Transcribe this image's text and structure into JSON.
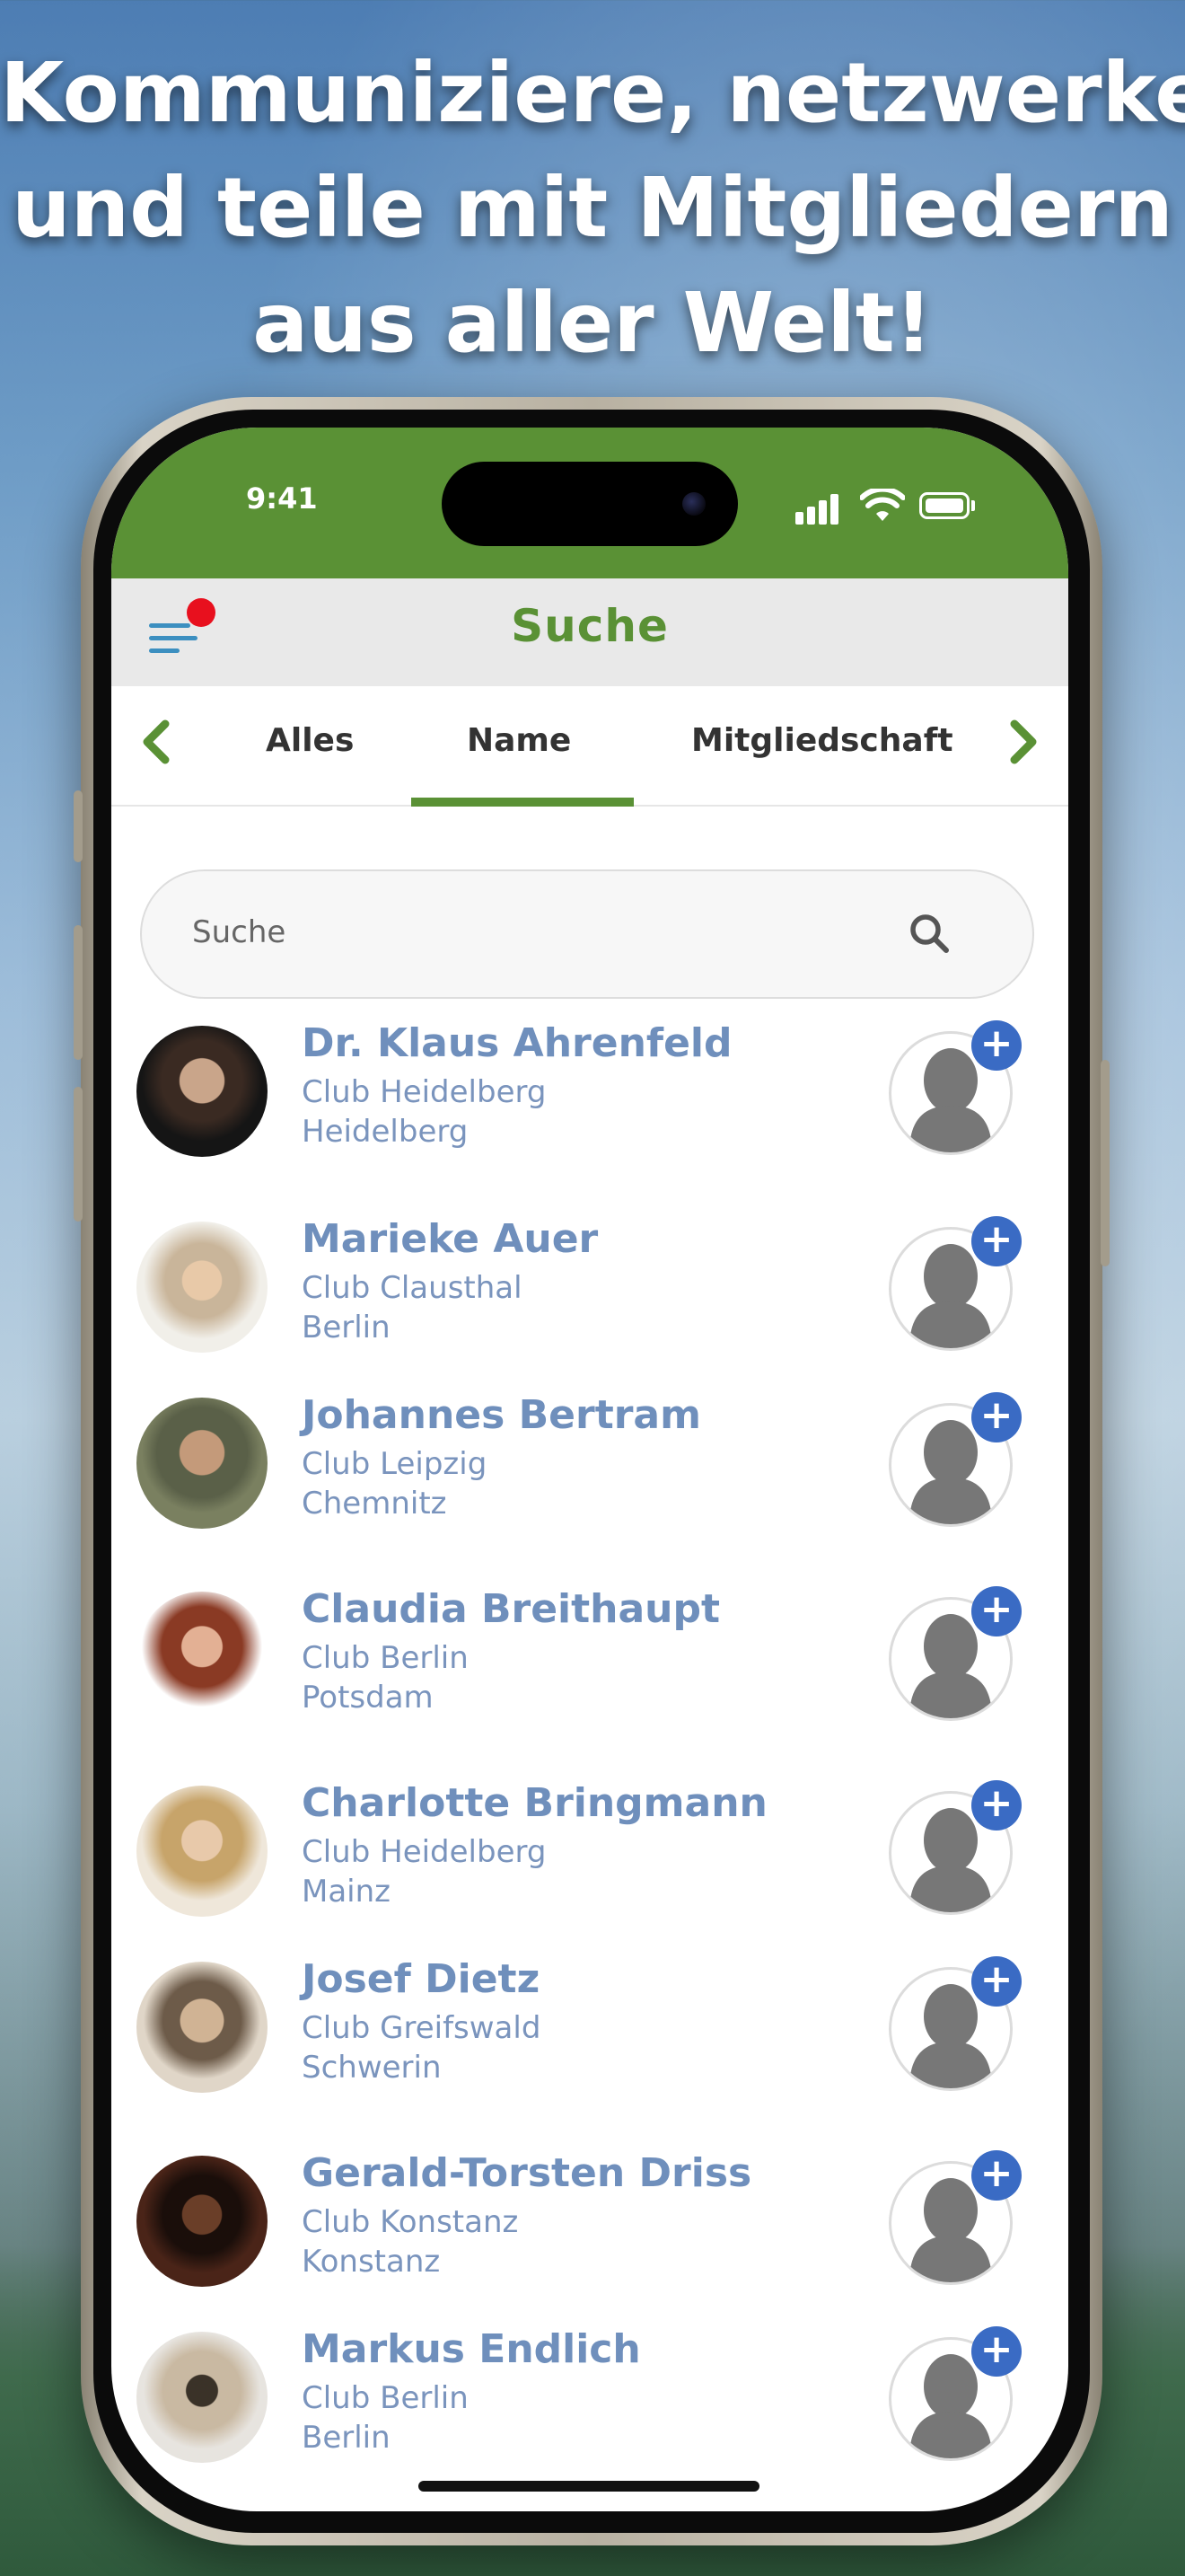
{
  "headline": {
    "line1": "Kommuniziere, netzwerke",
    "line2": "und teile mit Mitgliedern",
    "line3": "aus aller Welt!"
  },
  "status_bar": {
    "time": "9:41"
  },
  "header": {
    "title": "Suche"
  },
  "tabs": [
    {
      "label": "Alles",
      "selected": false
    },
    {
      "label": "Name",
      "selected": true
    },
    {
      "label": "Mitgliedschaft",
      "selected": false
    }
  ],
  "search": {
    "placeholder": "Suche"
  },
  "members": [
    {
      "name": "Dr. Klaus Ahrenfeld",
      "club": "Club Heidelberg",
      "city": "Heidelberg"
    },
    {
      "name": "Marieke Auer",
      "club": "Club Clausthal",
      "city": "Berlin"
    },
    {
      "name": "Johannes Bertram",
      "club": "Club Leipzig",
      "city": "Chemnitz"
    },
    {
      "name": "Claudia Breithaupt",
      "club": "Club Berlin",
      "city": "Potsdam"
    },
    {
      "name": "Charlotte Bringmann",
      "club": "Club Heidelberg",
      "city": "Mainz"
    },
    {
      "name": "Josef Dietz",
      "club": "Club Greifswald",
      "city": "Schwerin"
    },
    {
      "name": "Gerald-Torsten Driss",
      "club": "Club Konstanz",
      "city": "Konstanz"
    },
    {
      "name": "Markus Endlich",
      "club": "Club Berlin",
      "city": "Berlin"
    }
  ],
  "colors": {
    "brand_green": "#5a9135",
    "name_blue": "#6f8fbc",
    "add_blue": "#3a6bc4",
    "notif_red": "#e8101e"
  }
}
